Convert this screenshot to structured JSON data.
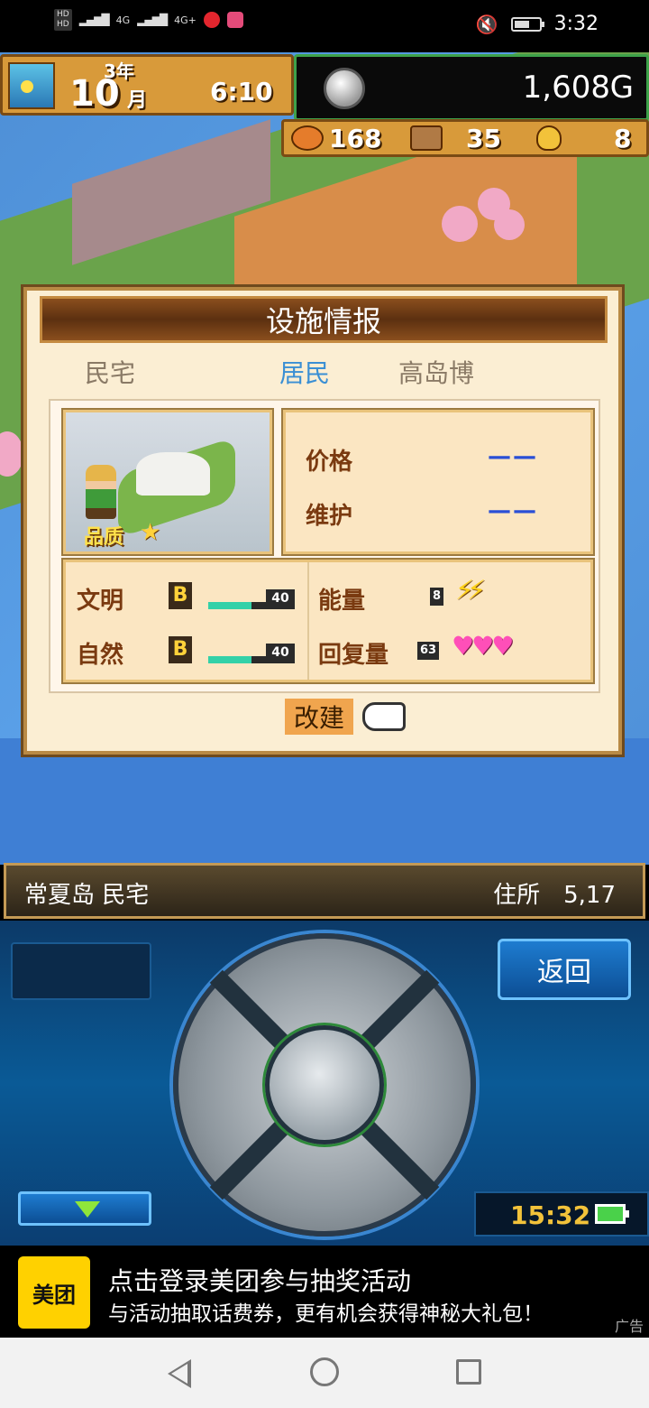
{
  "status_bar": {
    "time": "3:32",
    "net1": "4G",
    "net2": "4G+"
  },
  "hud": {
    "year": "3年",
    "month": "10",
    "month_label": "月",
    "time": "6:10",
    "gold": "1,608",
    "gold_unit": "G",
    "resources": [
      {
        "icon": "food-icon",
        "value": "168"
      },
      {
        "icon": "wood-icon",
        "value": "35"
      },
      {
        "icon": "medal-icon",
        "value": "8"
      }
    ]
  },
  "dialog": {
    "title": "设施情报",
    "tabs": [
      {
        "label": "民宅",
        "active": false
      },
      {
        "label": "居民",
        "active": true
      },
      {
        "label": "高岛博",
        "active": false
      }
    ],
    "quality_label": "品质",
    "price_label": "价格",
    "price_value": "——",
    "maintenance_label": "维护",
    "maintenance_value": "——",
    "stats": {
      "culture_label": "文明",
      "culture_grade": "B",
      "culture_value": "40",
      "culture_fill": 0.5,
      "nature_label": "自然",
      "nature_grade": "B",
      "nature_value": "40",
      "nature_fill": 0.5,
      "energy_label": "能量",
      "energy_value": "8",
      "recovery_label": "回复量",
      "recovery_value": "63",
      "bolts": "⚡⚡",
      "hearts": "♥♥♥"
    },
    "rebuild_label": "改建"
  },
  "location": {
    "name": "常夏岛 民宅",
    "address": "住所　5,17"
  },
  "controller": {
    "back_label": "返回",
    "game_time": "15:32"
  },
  "ad": {
    "logo": "美团",
    "title": "点击登录美团参与抽奖活动",
    "subtitle": "与活动抽取话费券，更有机会获得神秘大礼包！",
    "tag": "广告"
  }
}
